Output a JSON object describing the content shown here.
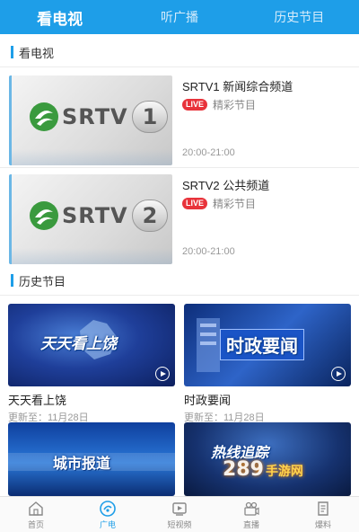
{
  "top_tabs": [
    {
      "label": "看电视",
      "active": true
    },
    {
      "label": "听广播",
      "active": false
    },
    {
      "label": "历史节目",
      "active": false
    }
  ],
  "sections": {
    "tv": "看电视",
    "history": "历史节目"
  },
  "channels": [
    {
      "brand": "SRTV",
      "number": "1",
      "title": "SRTV1 新闻综合频道",
      "live_badge": "LIVE",
      "desc": "精彩节目",
      "time": "20:00-21:00"
    },
    {
      "brand": "SRTV",
      "number": "2",
      "title": "SRTV2 公共频道",
      "live_badge": "LIVE",
      "desc": "精彩节目",
      "time": "20:00-21:00"
    }
  ],
  "history": [
    {
      "caption": "天天看上饶",
      "title": "天天看上饶",
      "date": "更新至：11月28日"
    },
    {
      "caption": "时政要闻",
      "title": "时政要闻",
      "date": "更新至：11月28日"
    },
    {
      "caption": "城市报道",
      "title": "",
      "date": ""
    },
    {
      "caption": "热线追踪",
      "title": "",
      "date": ""
    }
  ],
  "bottom_nav": [
    {
      "label": "首页",
      "icon": "home-icon",
      "active": false
    },
    {
      "label": "广电",
      "icon": "broadcast-icon",
      "active": true
    },
    {
      "label": "短视频",
      "icon": "short-video-icon",
      "active": false
    },
    {
      "label": "直播",
      "icon": "live-camera-icon",
      "active": false
    },
    {
      "label": "爆料",
      "icon": "report-icon",
      "active": false
    }
  ],
  "watermark": {
    "main": "289",
    "sub": "手游网"
  },
  "colors": {
    "accent": "#1e9ee8",
    "live": "#e8333b"
  }
}
